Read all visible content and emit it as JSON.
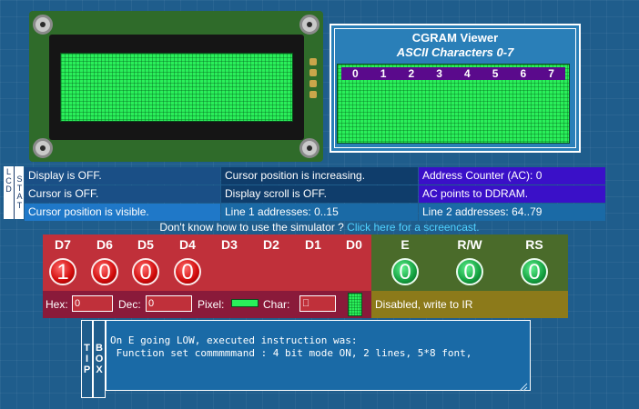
{
  "cgram": {
    "title": "CGRAM Viewer",
    "subtitle": "ASCII Characters 0-7",
    "columns": [
      "0",
      "1",
      "2",
      "3",
      "4",
      "5",
      "6",
      "7"
    ]
  },
  "lcd_stat_label": {
    "left": [
      "L",
      "C",
      "D"
    ],
    "right": [
      "S",
      "T",
      "A",
      "T"
    ]
  },
  "status": {
    "row1": [
      "Display is OFF.",
      "Cursor position is increasing.",
      "Address Counter (AC): 0"
    ],
    "row2": [
      "Cursor is OFF.",
      "Display scroll is OFF.",
      "AC points to DDRAM."
    ],
    "row3": [
      "Cursor position is visible.",
      "Line 1 addresses: 0..15",
      "Line 2 addresses: 64..79"
    ]
  },
  "help": {
    "question": "Don't know how to use the simulator ?",
    "link": "Click here for a screencast."
  },
  "data_bits": {
    "labels": [
      "D7",
      "D6",
      "D5",
      "D4",
      "D3",
      "D2",
      "D1",
      "D0"
    ],
    "values": [
      "1",
      "0",
      "0",
      "0"
    ]
  },
  "control_bits": {
    "labels": [
      "E",
      "R/W",
      "RS"
    ],
    "values": [
      "0",
      "0",
      "0"
    ]
  },
  "inputs": {
    "hex_label": "Hex:",
    "hex_value": "0",
    "dec_label": "Dec:",
    "dec_value": "0",
    "pixel_label": "Pixel:",
    "char_label": "Char:",
    "char_value": "\u0000"
  },
  "ir_status": "Disabled, write to IR",
  "tip": {
    "tip_letters": [
      "T",
      "I",
      "P"
    ],
    "box_letters": [
      "B",
      "O",
      "X"
    ],
    "text": "On E going LOW, executed instruction was:\n Function set commmmmand : 4 bit mode ON, 2 lines, 5*8 font,"
  },
  "colors": {
    "red_led": "#d00a0a",
    "green_led": "#14a040",
    "lcd_green": "#2aef5a"
  }
}
